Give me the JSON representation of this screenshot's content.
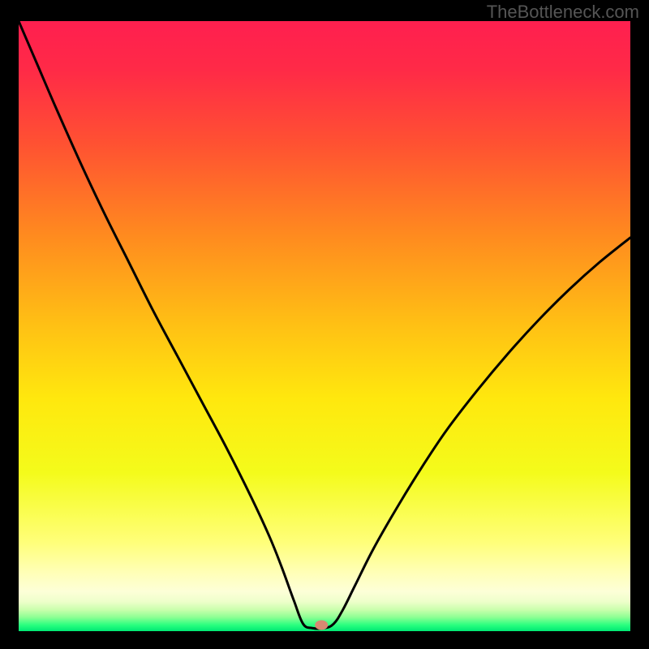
{
  "attribution": "TheBottleneck.com",
  "chart_data": {
    "type": "line",
    "title": "",
    "xlabel": "",
    "ylabel": "",
    "xlim": [
      0,
      100
    ],
    "ylim": [
      0,
      100
    ],
    "optimum_x": 48,
    "marker": {
      "x": 49.5,
      "y": 1.0,
      "color": "#d98872",
      "rx": 8,
      "ry": 6
    },
    "gradient_stops": [
      {
        "offset": 0.0,
        "color": "#ff1f4f"
      },
      {
        "offset": 0.08,
        "color": "#ff2a47"
      },
      {
        "offset": 0.2,
        "color": "#ff5132"
      },
      {
        "offset": 0.35,
        "color": "#ff8a1f"
      },
      {
        "offset": 0.5,
        "color": "#ffc114"
      },
      {
        "offset": 0.62,
        "color": "#ffe80e"
      },
      {
        "offset": 0.74,
        "color": "#f4fb1b"
      },
      {
        "offset": 0.855,
        "color": "#ffff7a"
      },
      {
        "offset": 0.905,
        "color": "#ffffb8"
      },
      {
        "offset": 0.935,
        "color": "#fdffd8"
      },
      {
        "offset": 0.952,
        "color": "#edffca"
      },
      {
        "offset": 0.965,
        "color": "#c9ffac"
      },
      {
        "offset": 0.977,
        "color": "#8eff94"
      },
      {
        "offset": 0.99,
        "color": "#2aff7f"
      },
      {
        "offset": 1.0,
        "color": "#00e874"
      }
    ],
    "curve": [
      {
        "x": 0.0,
        "y": 100.0
      },
      {
        "x": 3.0,
        "y": 93.0
      },
      {
        "x": 6.0,
        "y": 86.0
      },
      {
        "x": 10.0,
        "y": 77.0
      },
      {
        "x": 14.0,
        "y": 68.5
      },
      {
        "x": 18.0,
        "y": 60.5
      },
      {
        "x": 22.0,
        "y": 52.5
      },
      {
        "x": 26.0,
        "y": 45.0
      },
      {
        "x": 30.0,
        "y": 37.5
      },
      {
        "x": 34.0,
        "y": 30.0
      },
      {
        "x": 38.0,
        "y": 22.0
      },
      {
        "x": 41.0,
        "y": 15.5
      },
      {
        "x": 43.0,
        "y": 10.5
      },
      {
        "x": 45.0,
        "y": 5.0
      },
      {
        "x": 46.5,
        "y": 1.2
      },
      {
        "x": 48.0,
        "y": 0.5
      },
      {
        "x": 50.0,
        "y": 0.5
      },
      {
        "x": 51.5,
        "y": 1.2
      },
      {
        "x": 53.0,
        "y": 3.5
      },
      {
        "x": 55.0,
        "y": 7.5
      },
      {
        "x": 58.0,
        "y": 13.5
      },
      {
        "x": 62.0,
        "y": 20.5
      },
      {
        "x": 66.0,
        "y": 27.0
      },
      {
        "x": 70.0,
        "y": 33.0
      },
      {
        "x": 75.0,
        "y": 39.5
      },
      {
        "x": 80.0,
        "y": 45.5
      },
      {
        "x": 85.0,
        "y": 51.0
      },
      {
        "x": 90.0,
        "y": 56.0
      },
      {
        "x": 95.0,
        "y": 60.5
      },
      {
        "x": 100.0,
        "y": 64.5
      }
    ]
  }
}
